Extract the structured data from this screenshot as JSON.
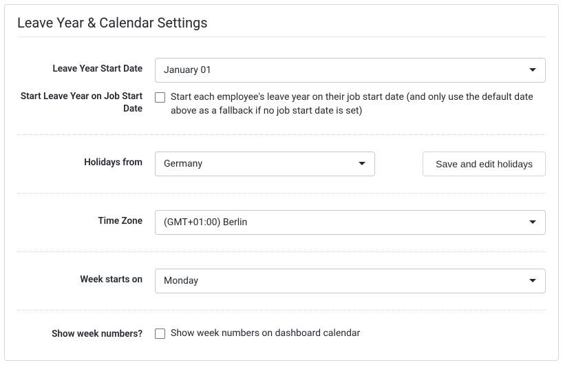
{
  "title": "Leave Year & Calendar Settings",
  "fields": {
    "leave_year_start": {
      "label": "Leave Year Start Date",
      "value": "January 01"
    },
    "job_start": {
      "label": "Start Leave Year on Job Start Date",
      "checkbox_text": "Start each employee's leave year on their job start date (and only use the default date above as a fallback if no job start date is set)"
    },
    "holidays_from": {
      "label": "Holidays from",
      "value": "Germany",
      "button": "Save and edit holidays"
    },
    "time_zone": {
      "label": "Time Zone",
      "value": "(GMT+01:00) Berlin"
    },
    "week_starts": {
      "label": "Week starts on",
      "value": "Monday"
    },
    "show_week_numbers": {
      "label": "Show week numbers?",
      "checkbox_text": "Show week numbers on dashboard calendar"
    }
  }
}
